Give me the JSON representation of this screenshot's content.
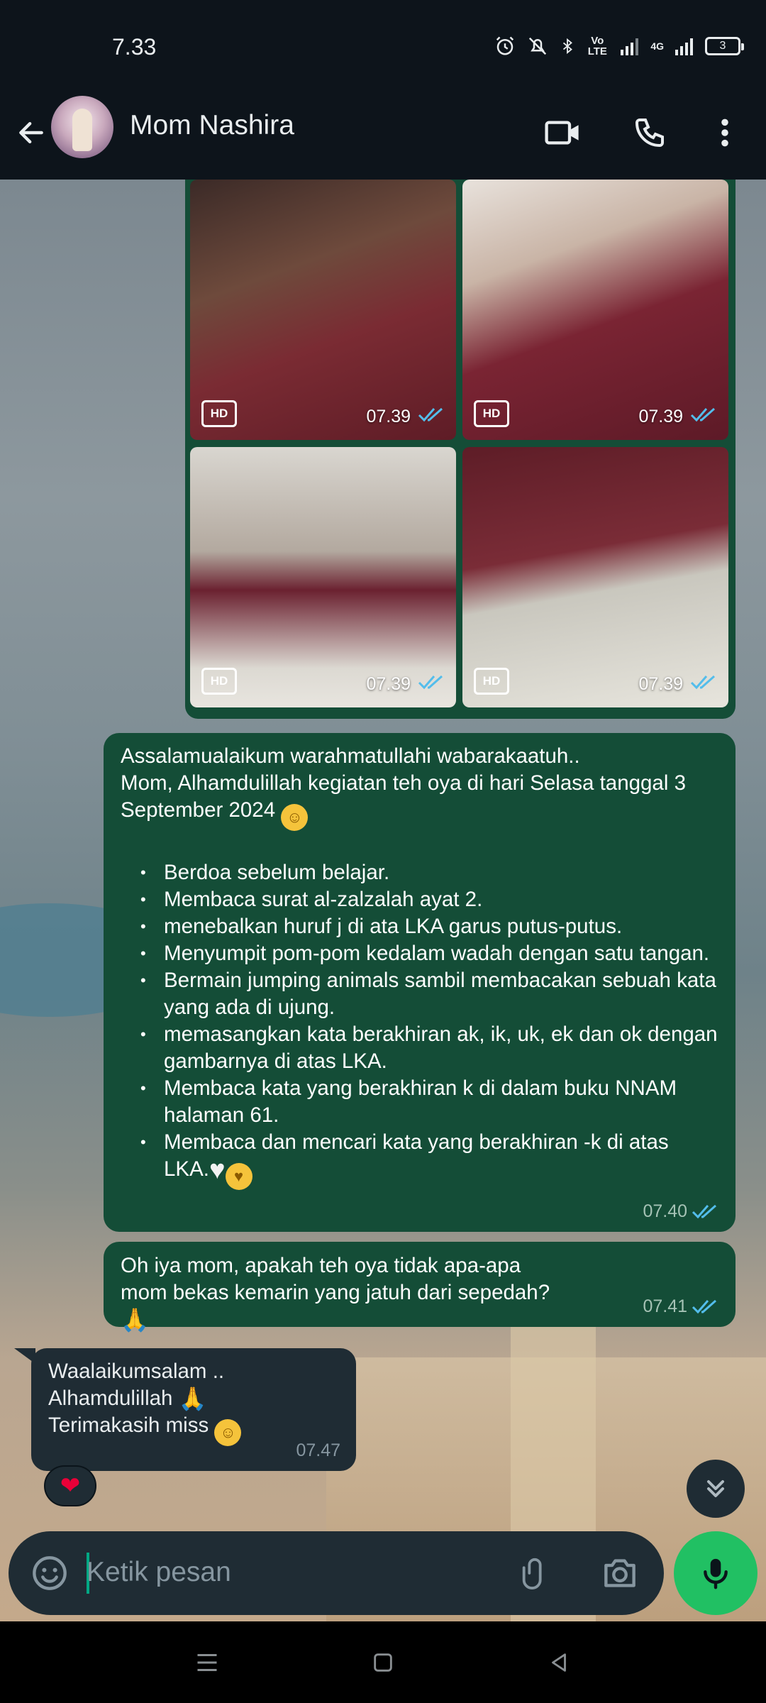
{
  "status_bar": {
    "time": "7.33",
    "lte_label": "Vo LTE",
    "network_label": "4G",
    "battery_level": "3"
  },
  "header": {
    "contact_name": "Mom Nashira",
    "icons": [
      "back-arrow-icon",
      "avatar",
      "video-call-icon",
      "phone-icon",
      "more-vert-icon"
    ]
  },
  "media_grid": {
    "tiles": [
      {
        "badge": "HD",
        "time": "07.39"
      },
      {
        "badge": "HD",
        "time": "07.39"
      },
      {
        "badge": "HD",
        "time": "07.39"
      },
      {
        "badge": "HD",
        "time": "07.39"
      }
    ]
  },
  "messages": {
    "m1": {
      "greeting": "Assalamualaikum warahmatullahi wabarakaatuh..",
      "intro": "Mom, Alhamdulillah kegiatan teh oya di hari Selasa tanggal 3 September 2024",
      "items": [
        "Berdoa sebelum belajar.",
        "Membaca surat al-zalzalah ayat 2.",
        "menebalkan huruf j di ata LKA garus putus-putus.",
        "Menyumpit pom-pom kedalam wadah dengan satu tangan.",
        "Bermain jumping animals sambil membacakan sebuah kata yang ada di ujung.",
        "memasangkan kata berakhiran ak, ik, uk, ek dan ok dengan gambarnya di atas LKA.",
        "Membaca kata yang berakhiran k di dalam buku NNAM halaman 61.",
        "Membaca dan mencari kata yang berakhiran -k di atas LKA."
      ],
      "time": "07.40"
    },
    "m2": {
      "text": "Oh iya mom, apakah teh oya tidak apa-apa mom bekas kemarin yang jatuh dari sepedah?",
      "time": "07.41"
    },
    "m3": {
      "line1": "Waalaikumsalam ..",
      "line2": "Alhamdulillah",
      "line3": "Terimakasih miss",
      "time": "07.47",
      "reaction": "❤"
    }
  },
  "composer": {
    "placeholder": "Ketik pesan"
  },
  "colors": {
    "outgoing_bubble": "#144d37",
    "incoming_bubble": "#1f2c34",
    "accent_green": "#21c063",
    "read_ticks": "#53bdeb"
  }
}
